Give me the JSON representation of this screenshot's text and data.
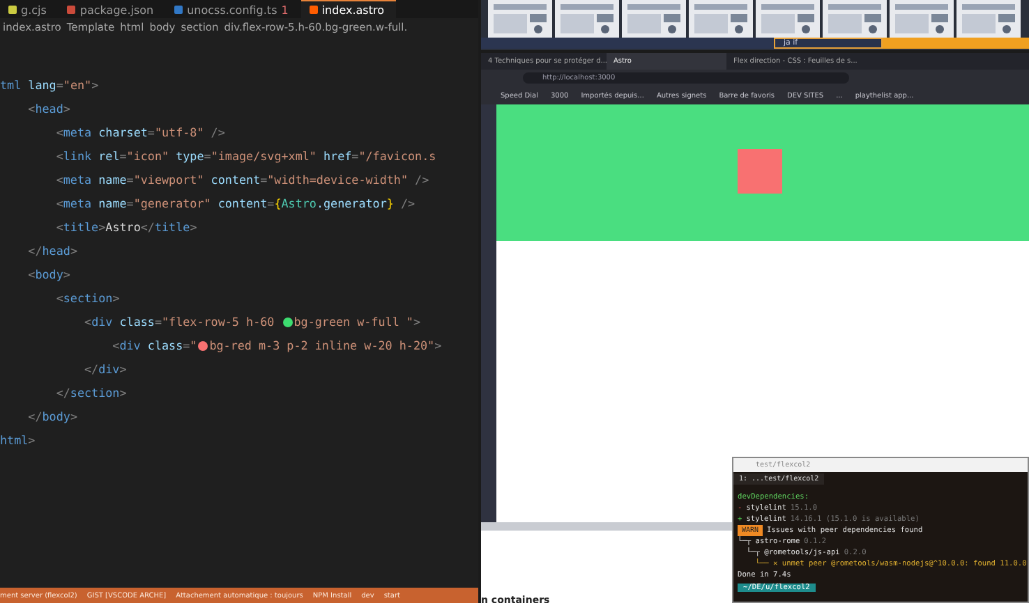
{
  "editor": {
    "tabs": [
      {
        "label": "g.cjs",
        "kind": "js",
        "selected": false
      },
      {
        "label": "package.json",
        "kind": "json",
        "selected": false
      },
      {
        "label": "unocss.config.ts",
        "kind": "ts",
        "badge": "1",
        "selected": false
      },
      {
        "label": "index.astro",
        "kind": "astro",
        "selected": true
      }
    ],
    "breadcrumb": [
      "index.astro",
      "Template",
      "html",
      "body",
      "section",
      "div.flex-row-5.h-60.bg-green.w-full."
    ],
    "lines": [
      [
        {
          "kind": "tag",
          "text": "tml"
        },
        {
          "kind": "attr",
          "text": " lang"
        },
        {
          "kind": "punct",
          "text": "="
        },
        {
          "kind": "string",
          "text": "\"en\""
        },
        {
          "kind": "punct",
          "text": ">"
        }
      ],
      [
        {
          "kind": "punct",
          "text": "    <"
        },
        {
          "kind": "tag",
          "text": "head"
        },
        {
          "kind": "punct",
          "text": ">"
        }
      ],
      [
        {
          "kind": "punct",
          "text": "        <"
        },
        {
          "kind": "tag",
          "text": "meta"
        },
        {
          "kind": "attr",
          "text": " charset"
        },
        {
          "kind": "punct",
          "text": "="
        },
        {
          "kind": "string",
          "text": "\"utf-8\""
        },
        {
          "kind": "punct",
          "text": " />"
        }
      ],
      [
        {
          "kind": "punct",
          "text": "        <"
        },
        {
          "kind": "tag",
          "text": "link"
        },
        {
          "kind": "attr",
          "text": " rel"
        },
        {
          "kind": "punct",
          "text": "="
        },
        {
          "kind": "string",
          "text": "\"icon\""
        },
        {
          "kind": "attr",
          "text": " type"
        },
        {
          "kind": "punct",
          "text": "="
        },
        {
          "kind": "string",
          "text": "\"image/svg+xml\""
        },
        {
          "kind": "attr",
          "text": " href"
        },
        {
          "kind": "punct",
          "text": "="
        },
        {
          "kind": "string",
          "text": "\"/favicon.s"
        }
      ],
      [
        {
          "kind": "punct",
          "text": "        <"
        },
        {
          "kind": "tag",
          "text": "meta"
        },
        {
          "kind": "attr",
          "text": " name"
        },
        {
          "kind": "punct",
          "text": "="
        },
        {
          "kind": "string",
          "text": "\"viewport\""
        },
        {
          "kind": "attr",
          "text": " content"
        },
        {
          "kind": "punct",
          "text": "="
        },
        {
          "kind": "string",
          "text": "\"width=device-width\""
        },
        {
          "kind": "punct",
          "text": " />"
        }
      ],
      [
        {
          "kind": "punct",
          "text": "        <"
        },
        {
          "kind": "tag",
          "text": "meta"
        },
        {
          "kind": "attr",
          "text": " name"
        },
        {
          "kind": "punct",
          "text": "="
        },
        {
          "kind": "string",
          "text": "\"generator\""
        },
        {
          "kind": "attr",
          "text": " content"
        },
        {
          "kind": "punct",
          "text": "="
        },
        {
          "kind": "brace",
          "text": "{"
        },
        {
          "kind": "ident",
          "text": "Astro"
        },
        {
          "kind": "attr",
          "text": ".generator"
        },
        {
          "kind": "brace",
          "text": "}"
        },
        {
          "kind": "punct",
          "text": " />"
        }
      ],
      [
        {
          "kind": "punct",
          "text": "        <"
        },
        {
          "kind": "tag",
          "text": "title"
        },
        {
          "kind": "punct",
          "text": ">"
        },
        {
          "kind": "text",
          "text": "Astro"
        },
        {
          "kind": "punct",
          "text": "</"
        },
        {
          "kind": "tag",
          "text": "title"
        },
        {
          "kind": "punct",
          "text": ">"
        }
      ],
      [
        {
          "kind": "punct",
          "text": "    </"
        },
        {
          "kind": "tag",
          "text": "head"
        },
        {
          "kind": "punct",
          "text": ">"
        }
      ],
      [
        {
          "kind": "punct",
          "text": "    <"
        },
        {
          "kind": "tag",
          "text": "body"
        },
        {
          "kind": "punct",
          "text": ">"
        }
      ],
      [
        {
          "kind": "punct",
          "text": "        <"
        },
        {
          "kind": "tag",
          "text": "section"
        },
        {
          "kind": "punct",
          "text": ">"
        }
      ],
      [
        {
          "kind": "punct",
          "text": "            <"
        },
        {
          "kind": "tag",
          "text": "div"
        },
        {
          "kind": "attr",
          "text": " class"
        },
        {
          "kind": "punct",
          "text": "="
        },
        {
          "kind": "string",
          "text": "\"flex-row-5 h-60 "
        },
        {
          "kind": "swatch",
          "color": "#3ddc70"
        },
        {
          "kind": "string",
          "text": "bg-green w-full \""
        },
        {
          "kind": "punct",
          "text": ">"
        }
      ],
      [
        {
          "kind": "punct",
          "text": "                <"
        },
        {
          "kind": "tag",
          "text": "div"
        },
        {
          "kind": "attr",
          "text": " class"
        },
        {
          "kind": "punct",
          "text": "="
        },
        {
          "kind": "string",
          "text": "\""
        },
        {
          "kind": "swatch",
          "color": "#f87171"
        },
        {
          "kind": "string",
          "text": "bg-red m-3 p-2 inline w-20 h-20\""
        },
        {
          "kind": "punct",
          "text": ">"
        }
      ],
      [
        {
          "kind": "punct",
          "text": "            </"
        },
        {
          "kind": "tag",
          "text": "div"
        },
        {
          "kind": "punct",
          "text": ">"
        }
      ],
      [
        {
          "kind": "punct",
          "text": "        </"
        },
        {
          "kind": "tag",
          "text": "section"
        },
        {
          "kind": "punct",
          "text": ">"
        }
      ],
      [
        {
          "kind": "punct",
          "text": "    </"
        },
        {
          "kind": "tag",
          "text": "body"
        },
        {
          "kind": "punct",
          "text": ">"
        }
      ],
      [
        {
          "kind": "tag",
          "text": "html"
        },
        {
          "kind": "punct",
          "text": ">"
        }
      ]
    ],
    "status_bar": [
      "ment server (flexcol2)",
      "GIST [VSCODE ARCHE]",
      "Attachement automatique : toujours",
      "NPM Install",
      "dev",
      "start"
    ]
  },
  "top_strip": {
    "search": "ja if"
  },
  "browser": {
    "tabs": [
      {
        "label": "4 Techniques pour se protéger d...",
        "selected": false
      },
      {
        "label": "Astro",
        "selected": true
      },
      {
        "label": "Flex direction - CSS : Feuilles de s...",
        "selected": false
      }
    ],
    "address": "http://localhost:3000",
    "bookmarks": [
      "Speed Dial",
      "3000",
      "Importés depuis...",
      "Autres signets",
      "Barre de favoris",
      "DEV SITES",
      "...",
      "playthelist app..."
    ]
  },
  "page_snippet": "n containers",
  "terminal": {
    "title": "test/flexcol2",
    "tab": "1: ...test/flexcol2",
    "lines": [
      {
        "kind": "heading",
        "text": "devDependencies:"
      },
      {
        "kind": "removed",
        "sign": "-",
        "text": "stylelint",
        "note": "15.1.0"
      },
      {
        "kind": "added",
        "sign": "+",
        "text": "stylelint",
        "note": "14.16.1 (15.1.0 is available)"
      },
      {
        "kind": "warn",
        "badge": "WARN",
        "text": "Issues with peer dependencies found"
      },
      {
        "kind": "tree",
        "text": "└─┬ astro-rome",
        "note": "0.1.2"
      },
      {
        "kind": "tree",
        "text": "  └─┬ @rometools/js-api",
        "note": "0.2.0"
      },
      {
        "kind": "unmet",
        "text": "    └── ✕ unmet peer @rometools/wasm-nodejs@^10.0.0: found 11.0.0"
      },
      {
        "kind": "plain",
        "text": "Done in 7.4s"
      }
    ],
    "prompt": "~/DE/u/flexcol2"
  }
}
